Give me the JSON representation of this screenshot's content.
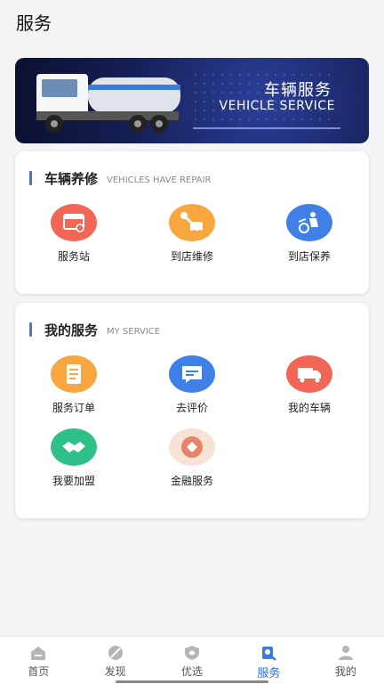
{
  "header": {
    "title": "服务"
  },
  "banner": {
    "title_cn": "车辆服务",
    "title_en": "VEHICLE SERVICE"
  },
  "sections": [
    {
      "title": "车辆养修",
      "subtitle": "VEHICLES HAVE REPAIR",
      "items": [
        {
          "label": "服务站",
          "icon": "service-station-icon",
          "color": "#f16654"
        },
        {
          "label": "到店维修",
          "icon": "wrench-repair-icon",
          "color": "#f7a640"
        },
        {
          "label": "到店保养",
          "icon": "maintenance-icon",
          "color": "#3f7fe8"
        }
      ]
    },
    {
      "title": "我的服务",
      "subtitle": "MY SERVICE",
      "items": [
        {
          "label": "服务订单",
          "icon": "order-icon",
          "color": "#f7a640"
        },
        {
          "label": "去评价",
          "icon": "comment-icon",
          "color": "#3f7fe8"
        },
        {
          "label": "我的车辆",
          "icon": "truck-icon",
          "color": "#f16654"
        },
        {
          "label": "我要加盟",
          "icon": "handshake-icon",
          "color": "#2fc08a"
        },
        {
          "label": "金融服务",
          "icon": "finance-icon",
          "color": "#f7e2d6"
        }
      ]
    }
  ],
  "tabbar": {
    "items": [
      {
        "label": "首页",
        "icon": "home-icon",
        "active": false
      },
      {
        "label": "发现",
        "icon": "discover-icon",
        "active": false
      },
      {
        "label": "优选",
        "icon": "shield-icon",
        "active": false
      },
      {
        "label": "服务",
        "icon": "service-icon",
        "active": true
      },
      {
        "label": "我的",
        "icon": "user-icon",
        "active": false
      }
    ]
  },
  "colors": {
    "accent": "#2f6fd8",
    "bar": "#3b7bde"
  }
}
